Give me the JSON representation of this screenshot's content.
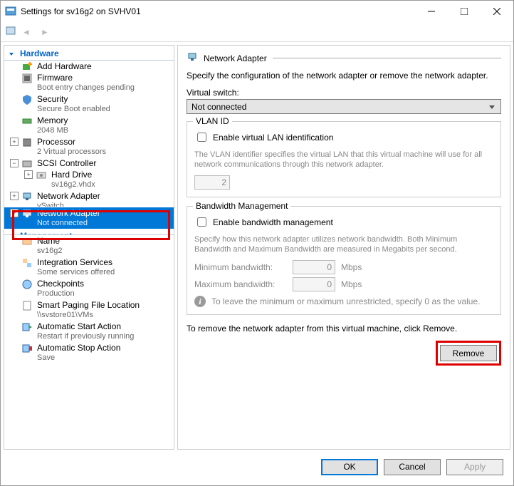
{
  "window": {
    "title": "Settings for sv16g2 on SVHV01"
  },
  "nav": {
    "back": "◄",
    "fwd": "►"
  },
  "tree": {
    "hardware": "Hardware",
    "addHardware": "Add Hardware",
    "firmware": {
      "label": "Firmware",
      "sub": "Boot entry changes pending"
    },
    "security": {
      "label": "Security",
      "sub": "Secure Boot enabled"
    },
    "memory": {
      "label": "Memory",
      "sub": "2048 MB"
    },
    "processor": {
      "label": "Processor",
      "sub": "2 Virtual processors"
    },
    "scsi": "SCSI Controller",
    "hdd": {
      "label": "Hard Drive",
      "sub": "sv16g2.vhdx"
    },
    "nic1": {
      "label": "Network Adapter",
      "sub": "vSwitch"
    },
    "nic2": {
      "label": "Network Adapter",
      "sub": "Not connected"
    },
    "management": "Management",
    "name": {
      "label": "Name",
      "sub": "sv16g2"
    },
    "integ": {
      "label": "Integration Services",
      "sub": "Some services offered"
    },
    "chkpt": {
      "label": "Checkpoints",
      "sub": "Production"
    },
    "paging": {
      "label": "Smart Paging File Location",
      "sub": "\\\\svstore01\\VMs"
    },
    "autostart": {
      "label": "Automatic Start Action",
      "sub": "Restart if previously running"
    },
    "autostop": {
      "label": "Automatic Stop Action",
      "sub": "Save"
    }
  },
  "panel": {
    "title": "Network Adapter",
    "desc": "Specify the configuration of the network adapter or remove the network adapter.",
    "vswitchLabel": "Virtual switch:",
    "vswitchValue": "Not connected",
    "vlan": {
      "legend": "VLAN ID",
      "check": "Enable virtual LAN identification",
      "help": "The VLAN identifier specifies the virtual LAN that this virtual machine will use for all network communications through this network adapter.",
      "value": "2"
    },
    "bw": {
      "legend": "Bandwidth Management",
      "check": "Enable bandwidth management",
      "help": "Specify how this network adapter utilizes network bandwidth. Both Minimum Bandwidth and Maximum Bandwidth are measured in Megabits per second.",
      "minLabel": "Minimum bandwidth:",
      "minValue": "0",
      "maxLabel": "Maximum bandwidth:",
      "maxValue": "0",
      "unit": "Mbps",
      "info": "To leave the minimum or maximum unrestricted, specify 0 as the value."
    },
    "removeText": "To remove the network adapter from this virtual machine, click Remove.",
    "removeBtn": "Remove"
  },
  "footer": {
    "ok": "OK",
    "cancel": "Cancel",
    "apply": "Apply"
  }
}
